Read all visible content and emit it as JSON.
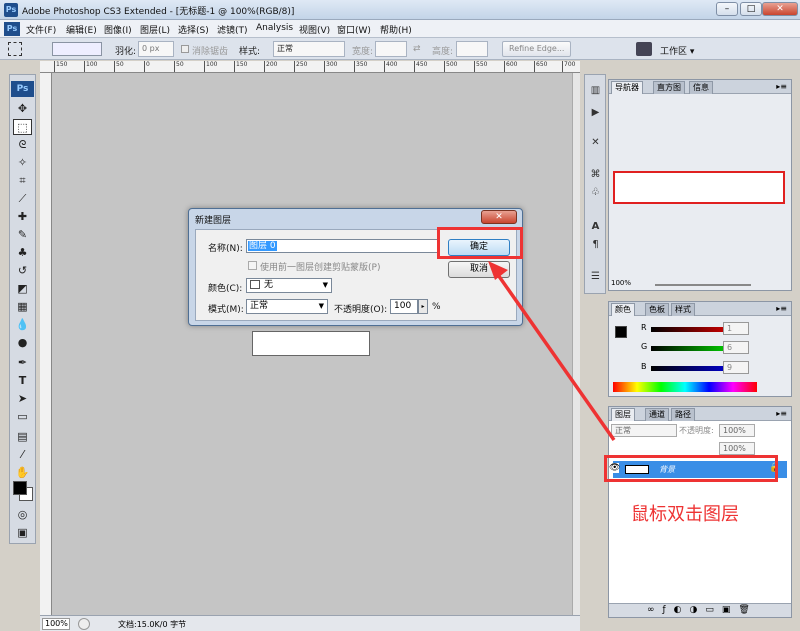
{
  "window": {
    "title": "Adobe Photoshop CS3 Extended - [无标题-1 @ 100%(RGB/8)]",
    "app_icon": "Ps",
    "minimize": "–",
    "maximize": "□",
    "close": "✕"
  },
  "menu": [
    "文件(F)",
    "编辑(E)",
    "图像(I)",
    "图层(L)",
    "选择(S)",
    "滤镜(T)",
    "Analysis",
    "视图(V)",
    "窗口(W)",
    "帮助(H)"
  ],
  "options": {
    "feather_label": "羽化:",
    "feather_value": "0 px",
    "antialias_label": "消除锯齿",
    "style_label": "样式:",
    "style_value": "正常",
    "width_label": "宽度:",
    "height_label": "高度:",
    "refine_edge": "Refine Edge...",
    "workspace": "工作区 ▾"
  },
  "rulers": {
    "top": [
      "150",
      "100",
      "50",
      "0",
      "50",
      "100",
      "150",
      "200",
      "250",
      "300",
      "350",
      "400",
      "450",
      "500",
      "550",
      "600",
      "650",
      "700"
    ]
  },
  "status": {
    "zoom": "100%",
    "doc": "文档:15.0K/0 字节"
  },
  "toolbox": {
    "logo": "Ps"
  },
  "navigator": {
    "tabs": [
      "导航器",
      "直方图",
      "信息"
    ],
    "zoom": "100%"
  },
  "color_panel": {
    "tabs": [
      "颜色",
      "色板",
      "样式"
    ],
    "channels": [
      {
        "label": "R",
        "value": "1"
      },
      {
        "label": "G",
        "value": "6"
      },
      {
        "label": "B",
        "value": "9"
      }
    ]
  },
  "layers_panel": {
    "tabs": [
      "图层",
      "通道",
      "路径"
    ],
    "blend_mode": "正常",
    "opacity_label": "不透明度:",
    "opacity_value": "100%",
    "fill_value": "100%",
    "layer_name": "背景"
  },
  "annotation": "鼠标双击图层",
  "dialog": {
    "title": "新建图层",
    "close": "✕",
    "name_label": "名称(N):",
    "name_value": "图层 0",
    "clip_label": "使用前一图层创建剪贴蒙版(P)",
    "color_label": "颜色(C):",
    "color_value": "无",
    "mode_label": "模式(M):",
    "mode_value": "正常",
    "opacity_label": "不透明度(O):",
    "opacity_value": "100",
    "percent": "%",
    "ok": "确定",
    "cancel": "取消"
  },
  "colors": {
    "highlight": "#ee3333",
    "selection": "#3a8ee6"
  }
}
